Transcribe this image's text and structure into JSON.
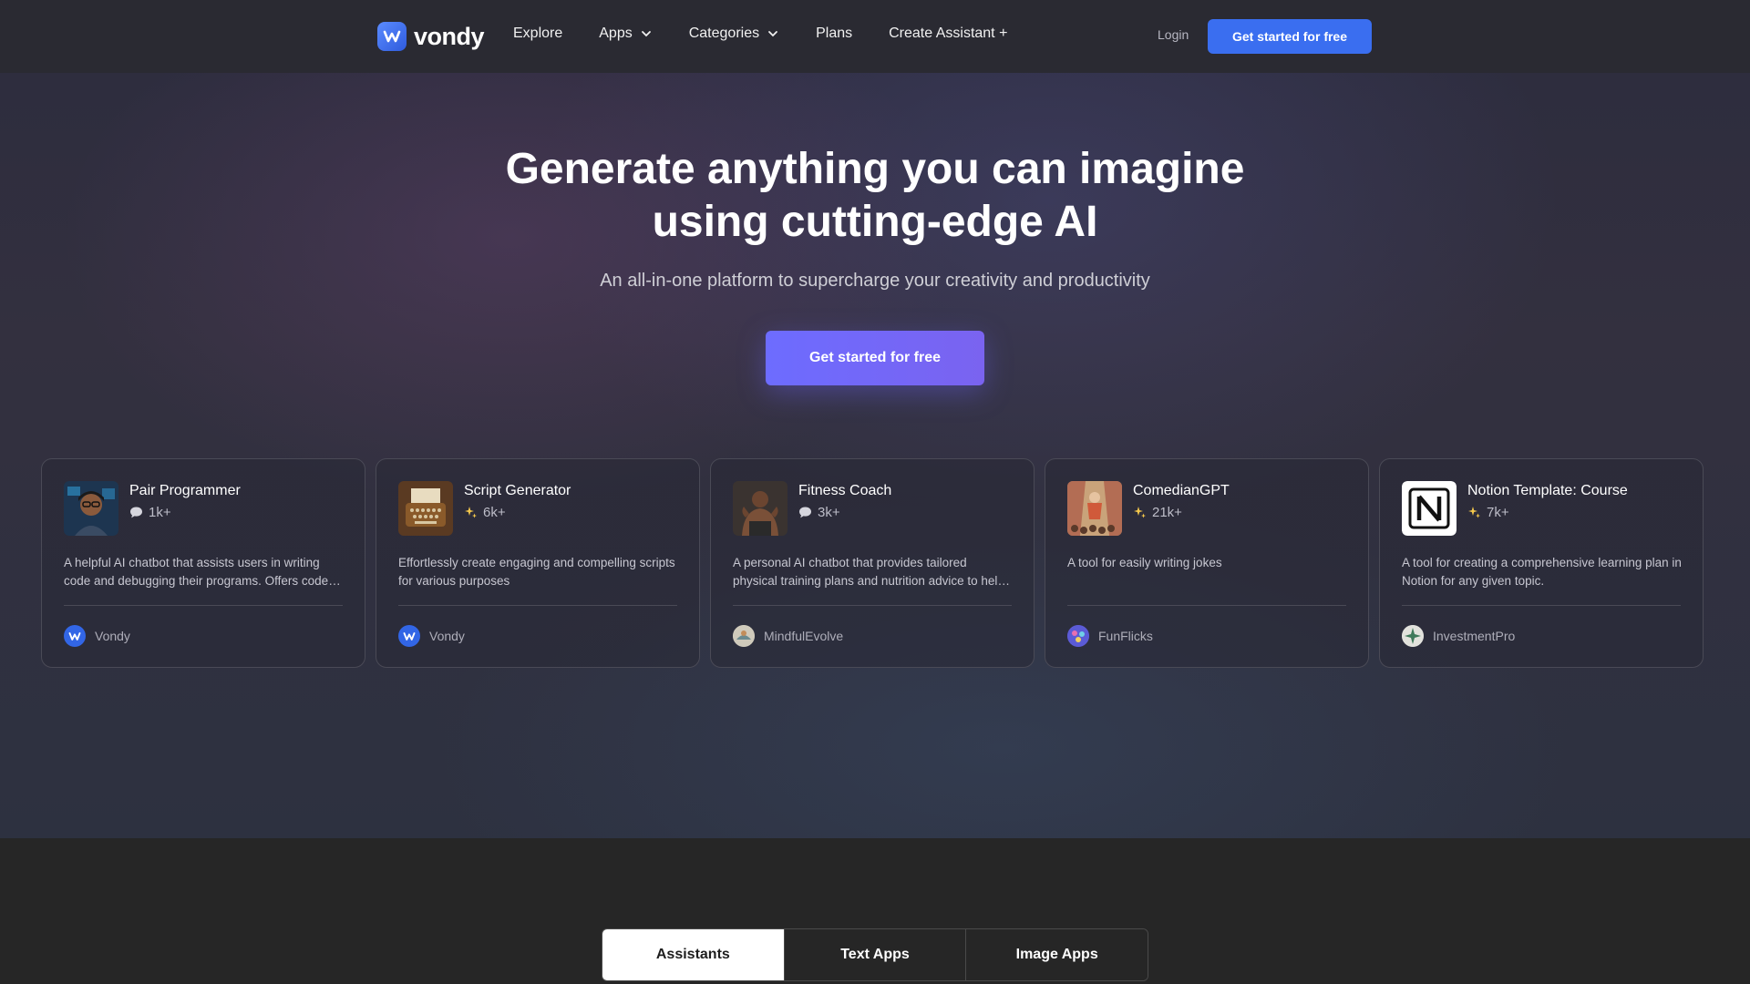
{
  "nav": {
    "logo_text": "vondy",
    "items": [
      {
        "label": "Explore",
        "dropdown": false
      },
      {
        "label": "Apps",
        "dropdown": true
      },
      {
        "label": "Categories",
        "dropdown": true
      },
      {
        "label": "Plans",
        "dropdown": false
      },
      {
        "label": "Create Assistant +",
        "dropdown": false
      }
    ],
    "login_label": "Login",
    "cta_label": "Get started for free"
  },
  "hero": {
    "headline_line1": "Generate anything you can imagine",
    "headline_line2": "using cutting-edge AI",
    "subheadline": "An all-in-one platform to supercharge your creativity and productivity",
    "cta_label": "Get started for free"
  },
  "cards": [
    {
      "title": "Pair Programmer",
      "stat_icon": "chat-icon",
      "stat": "1k+",
      "description": "A helpful AI chatbot that assists users in writing code and debugging their programs. Offers code suggestions and explanations.",
      "author": "Vondy",
      "thumb_icon": "programmer-portrait-icon"
    },
    {
      "title": "Script Generator",
      "stat_icon": "sparkle-icon",
      "stat": "6k+",
      "description": "Effortlessly create engaging and compelling scripts for various purposes",
      "author": "Vondy",
      "thumb_icon": "typewriter-icon"
    },
    {
      "title": "Fitness Coach",
      "stat_icon": "chat-icon",
      "stat": "3k+",
      "description": "A personal AI chatbot that provides tailored physical training plans and nutrition advice to help you reach your goals.",
      "author": "MindfulEvolve",
      "thumb_icon": "athlete-portrait-icon"
    },
    {
      "title": "ComedianGPT",
      "stat_icon": "sparkle-icon",
      "stat": "21k+",
      "description": "A tool for easily writing jokes",
      "author": "FunFlicks",
      "thumb_icon": "comedian-stage-icon"
    },
    {
      "title": "Notion Template: Course",
      "stat_icon": "sparkle-icon",
      "stat": "7k+",
      "description": "A tool for creating a comprehensive learning plan in Notion for any given topic.",
      "author": "InvestmentPro",
      "thumb_icon": "notion-logo-icon"
    }
  ],
  "tabs": [
    {
      "label": "Assistants",
      "active": true
    },
    {
      "label": "Text Apps",
      "active": false
    },
    {
      "label": "Image Apps",
      "active": false
    }
  ],
  "colors": {
    "accent": "#3a6ef0",
    "hero_cta": "#6d6cff",
    "background": "#262626"
  }
}
